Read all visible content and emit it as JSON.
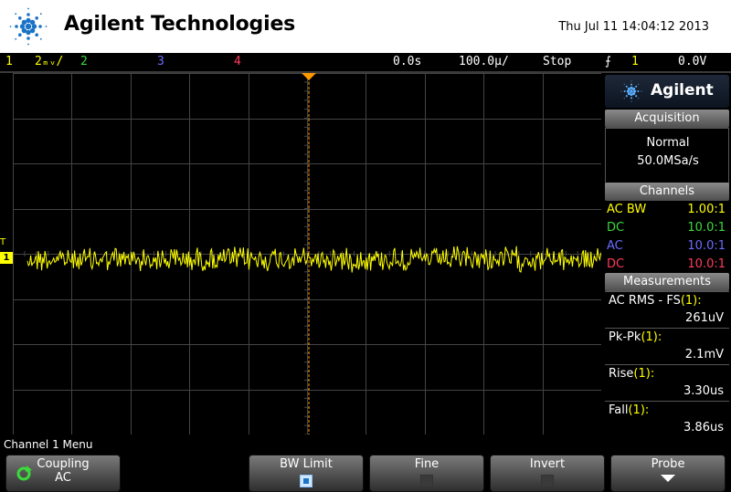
{
  "header": {
    "brand": "Agilent Technologies",
    "datetime": "Thu Jul 11 14:04:12 2013"
  },
  "status_bar": {
    "ch1": {
      "num": "1",
      "scale": "2ₘᵥ/",
      "color": "#ffff00"
    },
    "ch2": {
      "num": "2",
      "color": "#3adb3a"
    },
    "ch3": {
      "num": "3",
      "color": "#6b6bff"
    },
    "ch4": {
      "num": "4",
      "color": "#ff3b5c"
    },
    "delay": "0.0s",
    "timebase": "100.0µ/",
    "run_state": "Stop",
    "trigger_source": "1",
    "trigger_level": "0.0V"
  },
  "scope": {
    "ground_marker": "T",
    "channel_marker": "1",
    "trace_color": "#ffff00",
    "grid_color": "#444444",
    "trigger_line_color": "#ff9900"
  },
  "panel": {
    "logo": "Agilent",
    "acquisition": {
      "title": "Acquisition",
      "mode": "Normal",
      "sample_rate": "50.0MSa/s"
    },
    "channels": {
      "title": "Channels",
      "rows": [
        {
          "coupling": "AC BW",
          "probe": "1.00:1",
          "color": "#ffff00"
        },
        {
          "coupling": "DC",
          "probe": "10.0:1",
          "color": "#3adb3a"
        },
        {
          "coupling": "AC",
          "probe": "10.0:1",
          "color": "#6b6bff"
        },
        {
          "coupling": "DC",
          "probe": "10.0:1",
          "color": "#ff3b5c"
        }
      ]
    },
    "measurements": {
      "title": "Measurements",
      "items": [
        {
          "label": "AC RMS - FS",
          "channel": "(1):",
          "value": "261uV"
        },
        {
          "label": "Pk-Pk",
          "channel": "(1):",
          "value": "2.1mV"
        },
        {
          "label": "Rise",
          "channel": "(1):",
          "value": "3.30us"
        },
        {
          "label": "Fall",
          "channel": "(1):",
          "value": "3.86us"
        }
      ]
    }
  },
  "menu": {
    "title": "Channel 1 Menu",
    "softkeys": [
      {
        "label": "Coupling",
        "value": "AC"
      },
      {
        "label": "BW Limit",
        "checked": true
      },
      {
        "label": "Fine",
        "checked": false
      },
      {
        "label": "Invert",
        "checked": false
      },
      {
        "label": "Probe"
      }
    ]
  }
}
